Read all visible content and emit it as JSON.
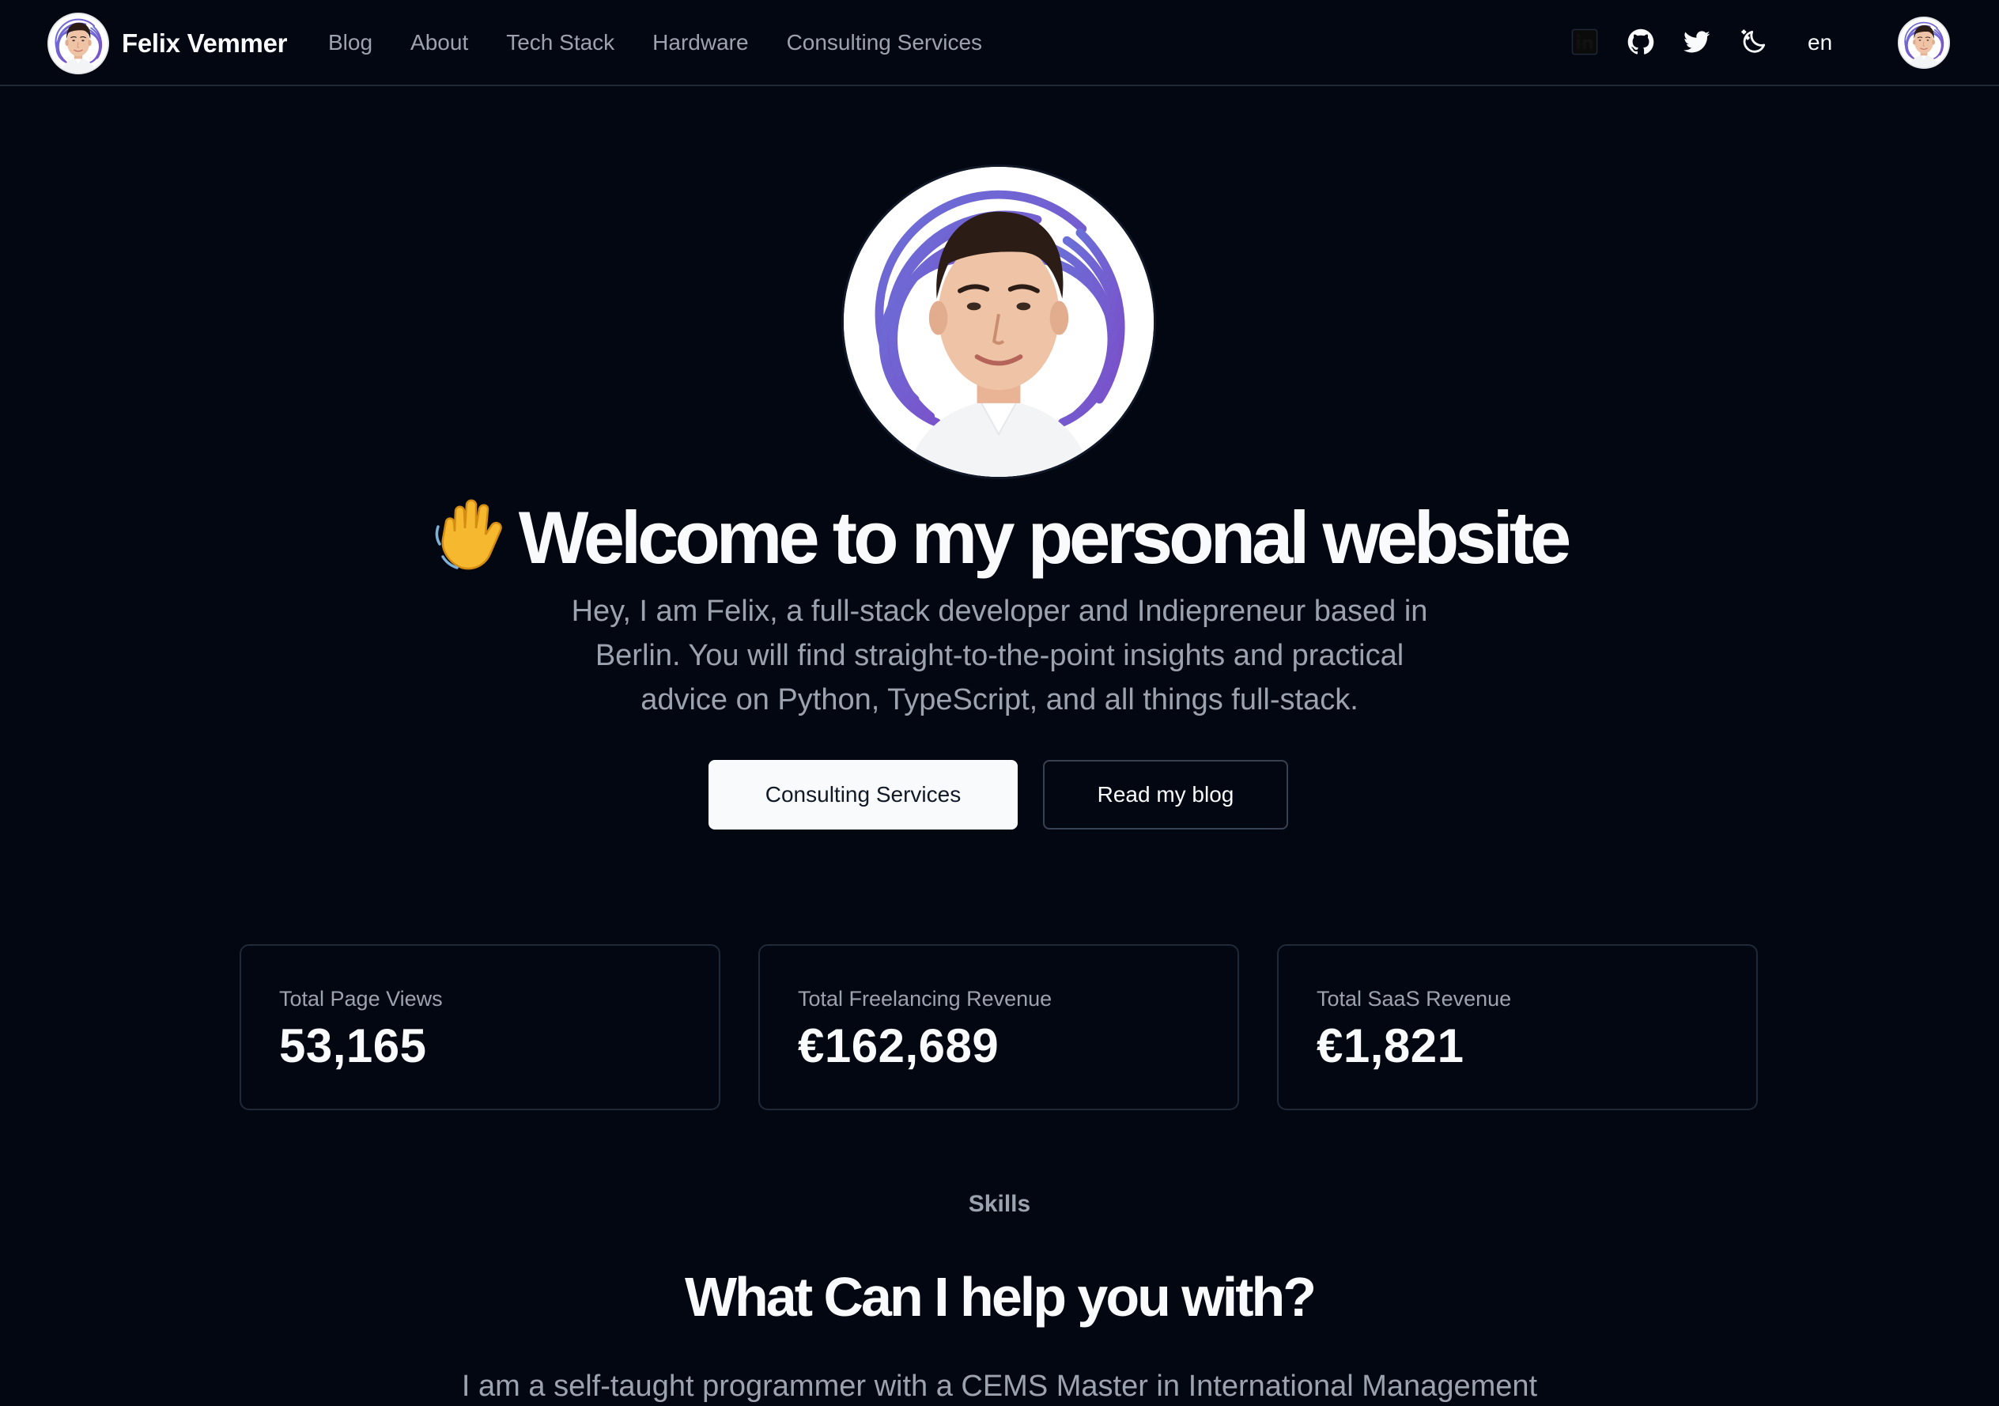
{
  "brand": {
    "name": "Felix Vemmer"
  },
  "nav": {
    "links": [
      "Blog",
      "About",
      "Tech Stack",
      "Hardware",
      "Consulting Services"
    ],
    "language": "en",
    "icons": [
      "linkedin-icon",
      "github-icon",
      "twitter-icon",
      "theme-toggle-icon"
    ]
  },
  "hero": {
    "title": "Welcome to my personal website",
    "emoji": "waving-hand",
    "subtitle": "Hey, I am Felix, a full-stack developer and Indiepreneur based in Berlin. You will find straight-to-the-point insights and practical advice on Python, TypeScript, and all things full-stack.",
    "primary_button": "Consulting Services",
    "secondary_button": "Read my blog"
  },
  "stats": [
    {
      "label": "Total Page Views",
      "value": "53,165"
    },
    {
      "label": "Total Freelancing Revenue",
      "value": "€162,689"
    },
    {
      "label": "Total SaaS Revenue",
      "value": "€1,821"
    }
  ],
  "skills": {
    "eyebrow": "Skills",
    "title": "What Can I help you with?",
    "intro_partial": "I am a self-taught programmer with a CEMS Master in International Management"
  },
  "colors": {
    "background": "#030712",
    "text": "#f9fafb",
    "muted": "#9ca3af",
    "border": "#1f2937",
    "avatar_ring": "#6366f1"
  }
}
